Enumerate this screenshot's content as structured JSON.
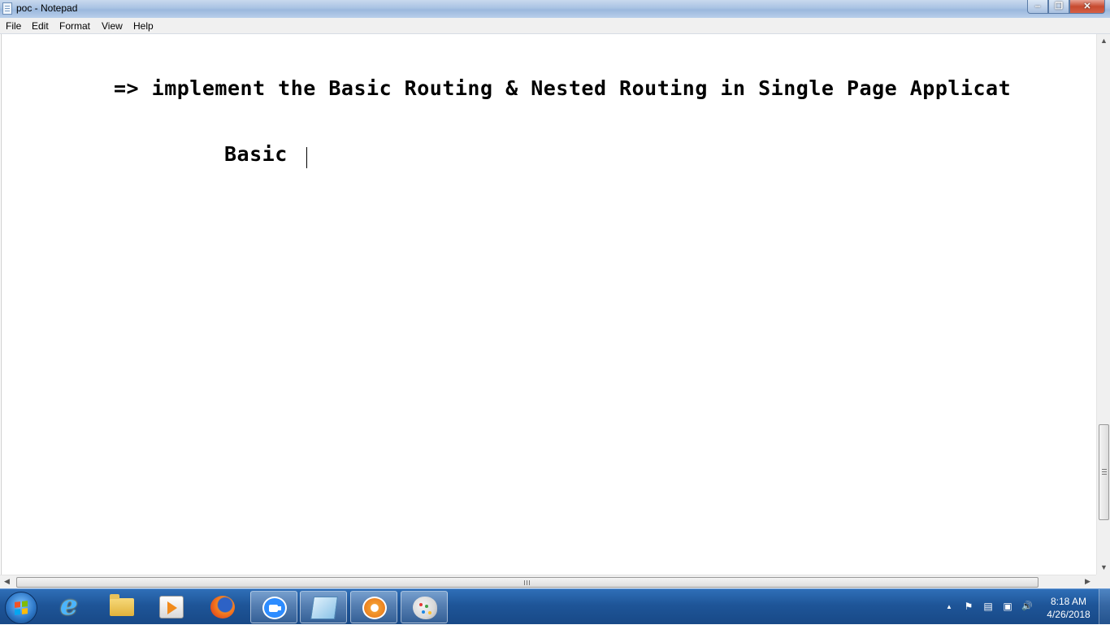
{
  "window": {
    "title": "poc - Notepad",
    "controls": {
      "minimize": "‒",
      "maximize": "❐",
      "close": "✕"
    }
  },
  "menu": {
    "items": [
      "File",
      "Edit",
      "Format",
      "View",
      "Help"
    ]
  },
  "editor": {
    "lines": [
      "=> implement the Basic Routing & Nested Routing in Single Page Applicat",
      "Basic "
    ]
  },
  "scrollbars": {
    "up": "▲",
    "down": "▼",
    "left": "◀",
    "right": "▶"
  },
  "taskbar": {
    "pinned": [
      "internet-explorer-icon",
      "windows-explorer-icon",
      "media-player-icon",
      "firefox-icon",
      "zoom-icon",
      "notepad-icon",
      "flower-app-icon",
      "paint-icon"
    ],
    "active": "notepad-icon",
    "tray": {
      "show_hidden": "▲",
      "flag": "⚑",
      "network": "▣",
      "volume": "🔊"
    },
    "clock": {
      "time": "8:18 AM",
      "date": "4/26/2018"
    }
  }
}
